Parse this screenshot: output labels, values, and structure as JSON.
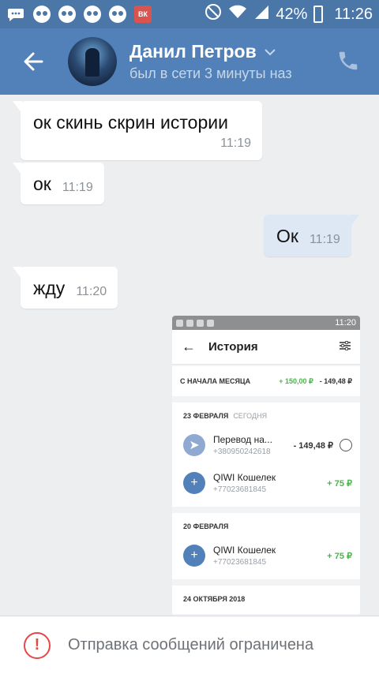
{
  "status_bar": {
    "battery": "42%",
    "time": "11:26",
    "vk_badge": "ВК",
    "icons": [
      "chat-bubble-icon",
      "skull-icon",
      "skull-icon",
      "skull-icon",
      "skull-icon",
      "vk-icon",
      "mute-icon",
      "wifi-icon",
      "signal-icon",
      "battery-icon"
    ]
  },
  "header": {
    "name": "Данил Петров",
    "status": "был в сети 3 минуты наз",
    "colors": {
      "bar": "#5181b8",
      "status_bar": "#4a76a8"
    }
  },
  "messages": [
    {
      "text": "ок скинь скрин истории",
      "time": "11:19",
      "direction": "in"
    },
    {
      "text": "ок",
      "time": "11:19",
      "direction": "in"
    },
    {
      "text": "Ок",
      "time": "11:19",
      "direction": "out"
    },
    {
      "text": "жду",
      "time": "11:20",
      "direction": "in"
    }
  ],
  "attachment": {
    "status_time": "11:20",
    "screen_title": "История",
    "summary": {
      "label": "С НАЧАЛА МЕСЯЦА",
      "income": "+ 150,00 ₽",
      "expense": "- 149,48 ₽"
    },
    "groups": [
      {
        "date": "23 ФЕВРАЛЯ",
        "tag": "СЕГОДНЯ",
        "items": [
          {
            "name": "Перевод на...",
            "account": "+380950242618",
            "amount": "- 149,48 ₽",
            "icon": "send-icon"
          },
          {
            "name": "QIWI Кошелек",
            "account": "+77023681845",
            "amount": "+ 75 ₽",
            "icon": "plus-icon"
          }
        ]
      },
      {
        "date": "20 ФЕВРАЛЯ",
        "tag": "",
        "items": [
          {
            "name": "QIWI Кошелек",
            "account": "+77023681845",
            "amount": "+ 75 ₽",
            "icon": "plus-icon"
          }
        ]
      },
      {
        "date": "24 ОКТЯБРЯ 2018",
        "tag": "",
        "items": []
      }
    ]
  },
  "bottom_bar": {
    "notice": "Отправка сообщений ограничена",
    "accent": "#e64646"
  }
}
